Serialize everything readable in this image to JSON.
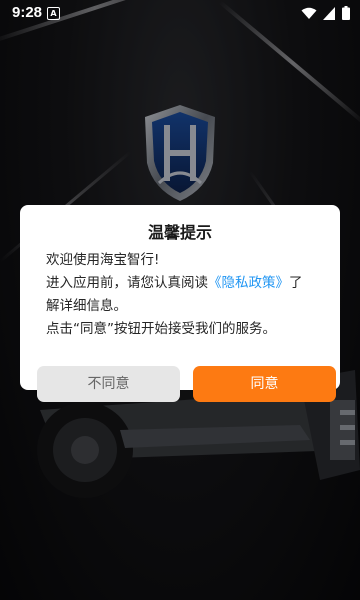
{
  "status_bar": {
    "time": "9:28",
    "notification_icon": "A",
    "icons": [
      "wifi-icon",
      "signal-icon",
      "battery-icon"
    ]
  },
  "dialog": {
    "title": "温馨提示",
    "greeting": "欢迎使用海宝智行!",
    "line2_prefix": "进入应用前，请您认真阅读",
    "policy_link": "《隐私政策》",
    "line2_suffix": "了",
    "line3": "解详细信息。",
    "line4": "点击“同意”按钮开始接受我们的服务。",
    "disagree_label": "不同意",
    "agree_label": "同意"
  },
  "colors": {
    "accent": "#fd7a12",
    "link": "#2196f3",
    "disagree_bg": "#e6e6e6"
  }
}
